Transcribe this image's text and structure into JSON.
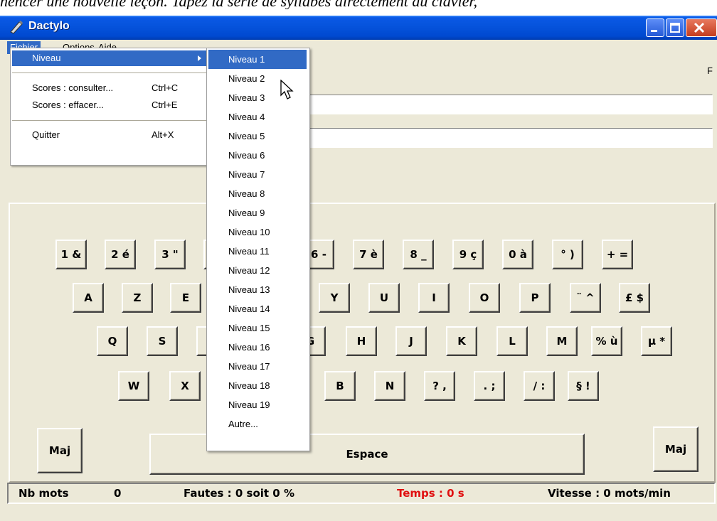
{
  "top_text": "nencer une nouvelle leçon. Tapez la série de syllabes directement au clavier,",
  "window": {
    "title": "Dactylo"
  },
  "menubar": [
    "Fichier",
    "Options",
    "Aide"
  ],
  "fichier_menu": {
    "niveau": "Niveau",
    "consulter": {
      "label": "Scores : consulter...",
      "shortcut": "Ctrl+C"
    },
    "effacer": {
      "label": "Scores : effacer...",
      "shortcut": "Ctrl+E"
    },
    "quitter": {
      "label": "Quitter",
      "shortcut": "Alt+X"
    }
  },
  "niveau_submenu": [
    "Niveau 1",
    "Niveau 2",
    "Niveau 3",
    "Niveau 4",
    "Niveau 5",
    "Niveau 6",
    "Niveau 7",
    "Niveau 8",
    "Niveau 9",
    "Niveau 10",
    "Niveau 11",
    "Niveau 12",
    "Niveau 13",
    "Niveau 14",
    "Niveau 15",
    "Niveau 16",
    "Niveau 17",
    "Niveau 18",
    "Niveau 19",
    "Autre..."
  ],
  "highlighted_submenu_item": "Niveau 1",
  "right_label": "F",
  "keyboard": {
    "row1": [
      "1 &",
      "2 é",
      "3 \"",
      "",
      "",
      "6 -",
      "7 è",
      "8 _",
      "9 ç",
      "0 à",
      "° )",
      "+ ="
    ],
    "row2": [
      "A",
      "Z",
      "E",
      "",
      "",
      "Y",
      "U",
      "I",
      "O",
      "P",
      "¨ ^",
      "£ $"
    ],
    "row3": [
      "Q",
      "S",
      "",
      "",
      "G",
      "H",
      "J",
      "K",
      "L",
      "M",
      "% ù",
      "µ *"
    ],
    "row4": [
      "W",
      "X",
      "",
      "",
      "B",
      "N",
      "? ,",
      ". ;",
      "/ :",
      "§ !"
    ],
    "shift_left": "Maj",
    "space": "Espace",
    "shift_right": "Maj"
  },
  "status": {
    "nb_mots_label": "Nb mots",
    "nb_mots_value": "0",
    "fautes": "Fautes : 0 soit 0 %",
    "temps": "Temps : 0 s",
    "vitesse": "Vitesse : 0 mots/min"
  },
  "colors": {
    "selection": "#316ac5",
    "temps": "#e01010",
    "face": "#ece9d8"
  }
}
